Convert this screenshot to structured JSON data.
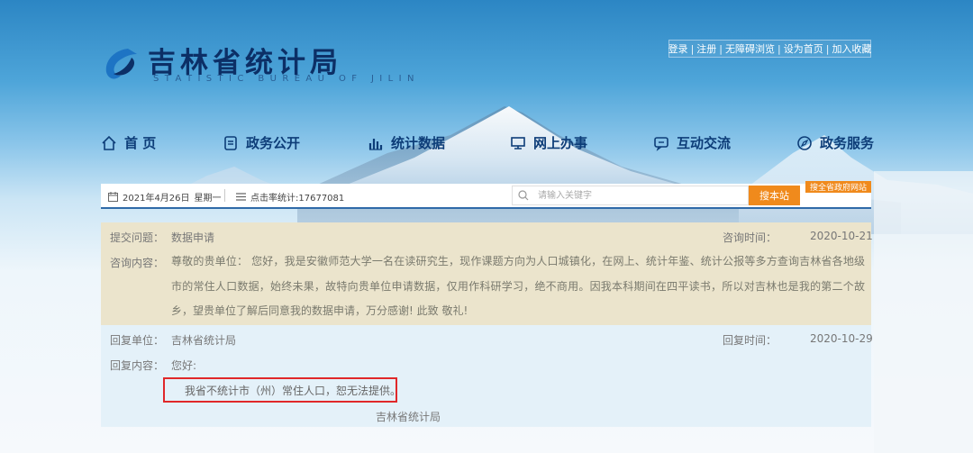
{
  "header": {
    "title": "吉林省统计局",
    "subtitle": "STATISTIC BUREAU OF JILIN",
    "top_links": [
      "登录",
      "注册",
      "无障碍浏览",
      "设为首页",
      "加入收藏"
    ]
  },
  "nav": {
    "items": [
      {
        "label": "首 页",
        "icon": "home-icon"
      },
      {
        "label": "政务公开",
        "icon": "document-icon"
      },
      {
        "label": "统计数据",
        "icon": "bar-chart-icon"
      },
      {
        "label": "网上办事",
        "icon": "monitor-icon"
      },
      {
        "label": "互动交流",
        "icon": "chat-icon"
      },
      {
        "label": "政务服务",
        "icon": "compass-icon"
      }
    ]
  },
  "infobar": {
    "date": "2021年4月26日",
    "weekday": "星期一",
    "visits": "点击率统计:17677081",
    "search_placeholder": "请输入关键字",
    "search_button": "搜本站",
    "jump_link": "搜全省政府网站"
  },
  "question": {
    "topic_label": "提交问题：",
    "topic": "数据申请",
    "time_label": "咨询时间：",
    "time": "2020-10-21",
    "content_label": "咨询内容：",
    "content": "尊敬的贵单位：     您好，我是安徽师范大学一名在读研究生，现作课题方向为人口城镇化，在网上、统计年鉴、统计公报等多方查询吉林省各地级市的常住人口数据，始终未果，故特向贵单位申请数据，仅用作科研学习，绝不商用。因我本科期间在四平读书，所以对吉林也是我的第二个故乡，望贵单位了解后同意我的数据申请，万分感谢!       此致       敬礼!"
  },
  "reply": {
    "unit_label": "回复单位：",
    "unit": "吉林省统计局",
    "time_label": "回复时间：",
    "time": "2020-10-29",
    "content_label": "回复内容：",
    "greeting": "您好:",
    "answer": "我省不统计市（州）常住人口，恕无法提供。",
    "signature": "吉林省统计局"
  },
  "colors": {
    "nav_text": "#0d3d78",
    "accent_orange": "#f08a1c",
    "question_bg": "#ebe4cc",
    "reply_bg": "#e4f1f9",
    "highlight_border": "#e0282a"
  }
}
